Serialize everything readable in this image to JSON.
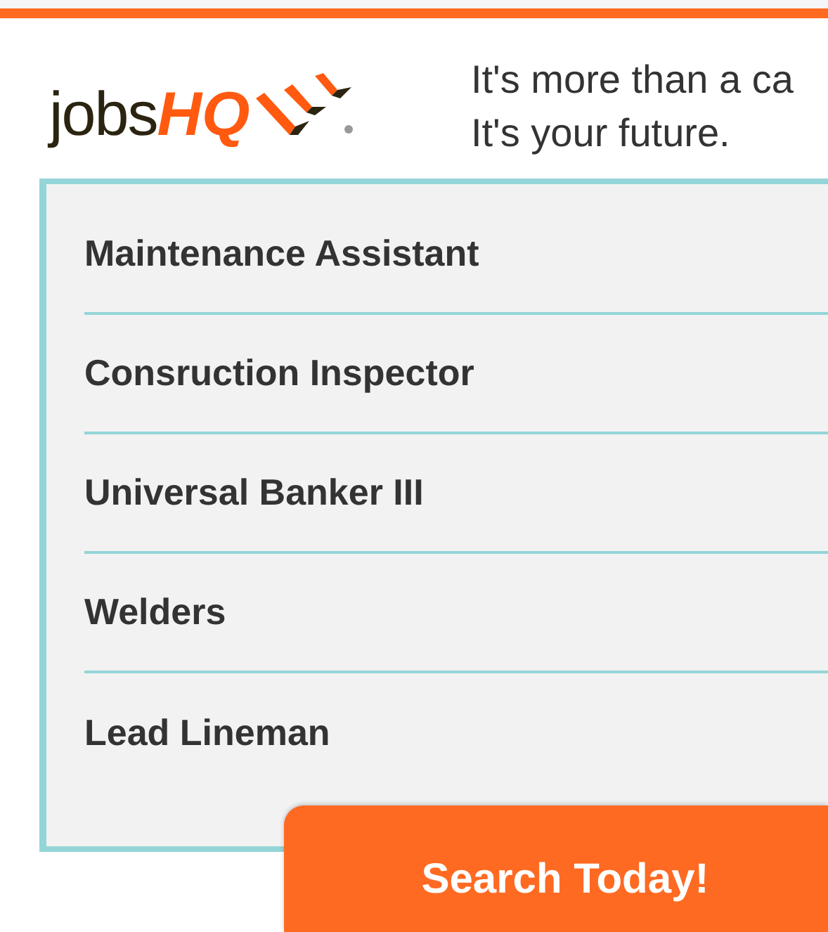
{
  "logo": {
    "text": "jobs",
    "accent": "HQ"
  },
  "tagline": [
    "It's more than a ca",
    "It's your future."
  ],
  "jobs": [
    "Maintenance Assistant",
    "Consruction Inspector",
    "Universal Banker III",
    "Welders",
    "Lead Lineman"
  ],
  "button": "Search Today!"
}
